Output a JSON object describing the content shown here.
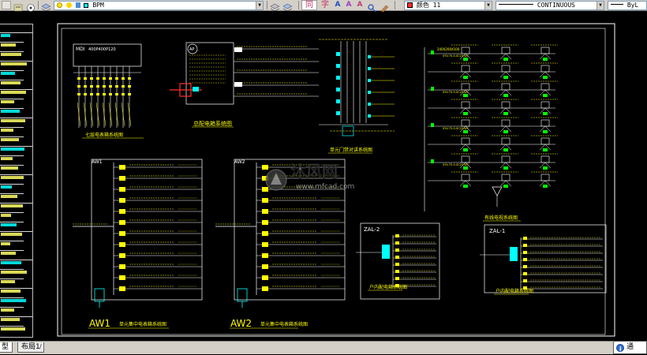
{
  "toolbar": {
    "layer_value": "BPM",
    "color_value": "颜色 11",
    "linetype_value": "CONTINUOUS",
    "lineweight_value": "ByL",
    "text_glyphs": [
      "同",
      "字",
      "A",
      "A",
      "A"
    ]
  },
  "drawing": {
    "panel_titles": {
      "distribution_system": "总配电箱系统图",
      "seventh_floor": "七层电表箱系统图",
      "unit_door_phone": "单元门禁对讲系统图",
      "cable_tv": "有线电视系统图",
      "aw1": "AW1",
      "aw1_title": "单元集中电表箱系统图",
      "aw2": "AW2",
      "aw2_title": "单元集中电表箱系统图",
      "zal2_box": "ZAL-2",
      "zal2_title": "户内配电箱系统图",
      "zal1_box": "ZAL-1",
      "zal1_title": "户内配电箱系统图"
    },
    "tags": {
      "mdi": "MDI",
      "box_rating": "400P400P120",
      "ap": "AP",
      "aw1_box": "AW1",
      "aw2_box": "AW2"
    },
    "tv_labels": [
      "240X200X100",
      "SYV-75-5-SC25-WC"
    ],
    "watermark": {
      "brand": "沐风网",
      "url": "www.mfcad.com"
    }
  },
  "tabs": {
    "model": "型",
    "layout1": "布局1"
  },
  "tip": {
    "text": "通"
  },
  "colors": {
    "background": "#000000",
    "frame": "#ffffff",
    "cyan": "#00ffff",
    "yellow": "#ffff00",
    "green": "#00ff00",
    "red": "#ff3030",
    "white": "#ffffff"
  }
}
